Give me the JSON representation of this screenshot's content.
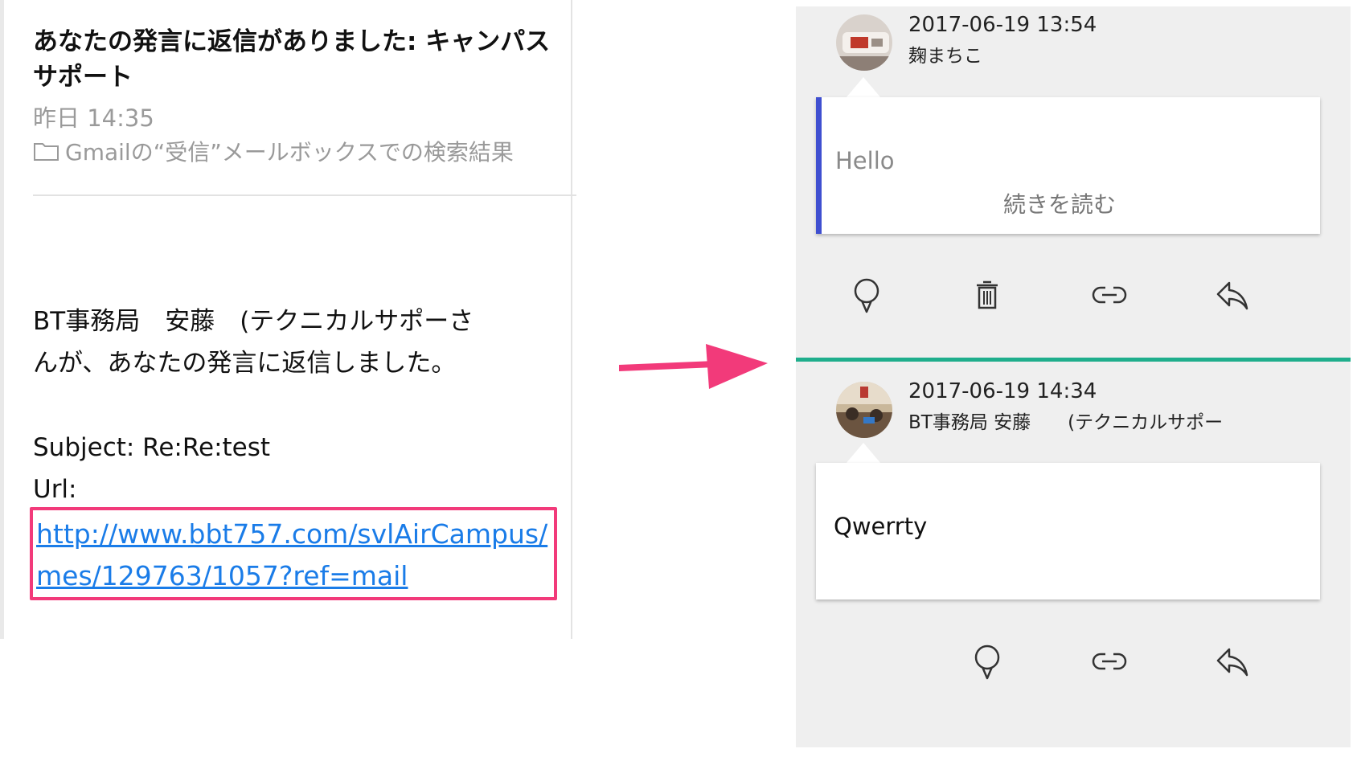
{
  "email": {
    "subject": "あなたの発言に返信がありました: キャンパスサポート",
    "date": "昨日 14:35",
    "folder": "Gmailの“受信”メールボックスでの検索結果",
    "body_line1": "BT事務局　安藤　(テクニカルサポーさ",
    "body_line2": "んが、あなたの発言に返信しました。",
    "subject_line": "Subject: Re:Re:test",
    "url_label": "Url:",
    "url": "http://www.bbt757.com/svlAirCampus/mes/129763/1057?ref=mail"
  },
  "colors": {
    "highlight_box": "#f23a7a",
    "link": "#1a7ce8",
    "arrow": "#f23a7a",
    "accent_bar": "#3f4fd0",
    "divider": "#1fae8c"
  },
  "posts": [
    {
      "time": "2017-06-19 13:54",
      "author": "麹まちこ",
      "text": "Hello",
      "readmore": "続きを読む",
      "actions": [
        "pin-icon",
        "trash-icon",
        "link-icon",
        "reply-icon"
      ]
    },
    {
      "time": "2017-06-19 14:34",
      "author": "BT事務局  安藤　　(テクニカルサポー",
      "text": "Qwerrty",
      "actions": [
        "pin-icon",
        "link-icon",
        "reply-icon"
      ]
    }
  ]
}
